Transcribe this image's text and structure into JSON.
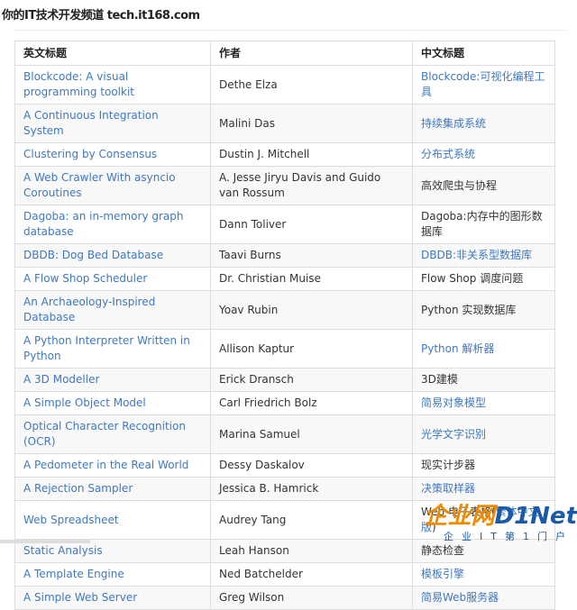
{
  "watermark_top": "你的IT技术开发频道 tech.it168.com",
  "headers": [
    "英文标题",
    "作者",
    "中文标题"
  ],
  "rows": [
    {
      "en": "Blockcode: A visual programming toolkit",
      "author": "Dethe Elza",
      "zh": [
        {
          "t": "Blockcode:可视化编程工具",
          "link": true
        }
      ]
    },
    {
      "en": "A Continuous Integration System",
      "author": "Malini Das",
      "zh": [
        {
          "t": "持续集成系统",
          "link": true
        }
      ]
    },
    {
      "en": "Clustering by Consensus",
      "author": "Dustin J. Mitchell",
      "zh": [
        {
          "t": "分布式系统",
          "link": true
        }
      ]
    },
    {
      "en": "A Web Crawler With asyncio Coroutines",
      "author": "A. Jesse Jiryu Davis and Guido van Rossum",
      "zh": [
        {
          "t": "高效爬虫与协程",
          "link": false
        }
      ]
    },
    {
      "en": "Dagoba: an in-memory graph database",
      "author": "Dann Toliver",
      "zh": [
        {
          "t": "Dagoba:内存中的图形数据库",
          "link": false
        }
      ]
    },
    {
      "en": "DBDB: Dog Bed Database",
      "author": "Taavi Burns",
      "zh": [
        {
          "t": "DBDB:非关系型数据库",
          "link": true
        }
      ]
    },
    {
      "en": "A Flow Shop Scheduler",
      "author": "Dr. Christian Muise",
      "zh": [
        {
          "t": "Flow Shop 调度问题",
          "link": false
        }
      ]
    },
    {
      "en": "An Archaeology-Inspired Database",
      "author": "Yoav Rubin",
      "zh": [
        {
          "t": "Python 实现数据库",
          "link": false
        }
      ]
    },
    {
      "en": "A Python Interpreter Written in Python",
      "author": "Allison Kaptur",
      "zh": [
        {
          "t": "Python 解析器",
          "link": true
        }
      ]
    },
    {
      "en": "A 3D Modeller",
      "author": "Erick Dransch",
      "zh": [
        {
          "t": "3D建模",
          "link": false
        }
      ]
    },
    {
      "en": "A Simple Object Model",
      "author": "Carl Friedrich Bolz",
      "zh": [
        {
          "t": "简易对象模型",
          "link": true
        }
      ]
    },
    {
      "en": "Optical Character Recognition (OCR)",
      "author": "Marina Samuel",
      "zh": [
        {
          "t": "光学文字识别",
          "link": true
        }
      ]
    },
    {
      "en": "A Pedometer in the Real World",
      "author": "Dessy Daskalov",
      "zh": [
        {
          "t": "现实计步器",
          "link": false
        }
      ]
    },
    {
      "en": "A Rejection Sampler",
      "author": "Jessica B. Hamrick",
      "zh": [
        {
          "t": "决策取样器",
          "link": true
        }
      ]
    },
    {
      "en": "Web Spreadsheet",
      "author": "Audrey Tang",
      "zh": [
        {
          "t": "Web 电子表格(",
          "link": false
        },
        {
          "t": "繁体中文版",
          "link": true
        },
        {
          "t": ")",
          "link": false
        }
      ]
    },
    {
      "en": "Static Analysis",
      "author": "Leah Hanson",
      "zh": [
        {
          "t": "静态检查",
          "link": false
        }
      ]
    },
    {
      "en": "A Template Engine",
      "author": "Ned Batchelder",
      "zh": [
        {
          "t": "模板引擎",
          "link": true
        }
      ]
    },
    {
      "en": "A Simple Web Server",
      "author": "Greg Wilson",
      "zh": [
        {
          "t": "简易Web服务器",
          "link": true
        }
      ]
    }
  ],
  "footer": {
    "logo_a": "企业网",
    "logo_b": "D1Net",
    "tagline": "企业IT第1门户"
  },
  "colors": {
    "link": "#4078c0",
    "stripe": "#f8f8f8",
    "border": "#dddddd"
  }
}
